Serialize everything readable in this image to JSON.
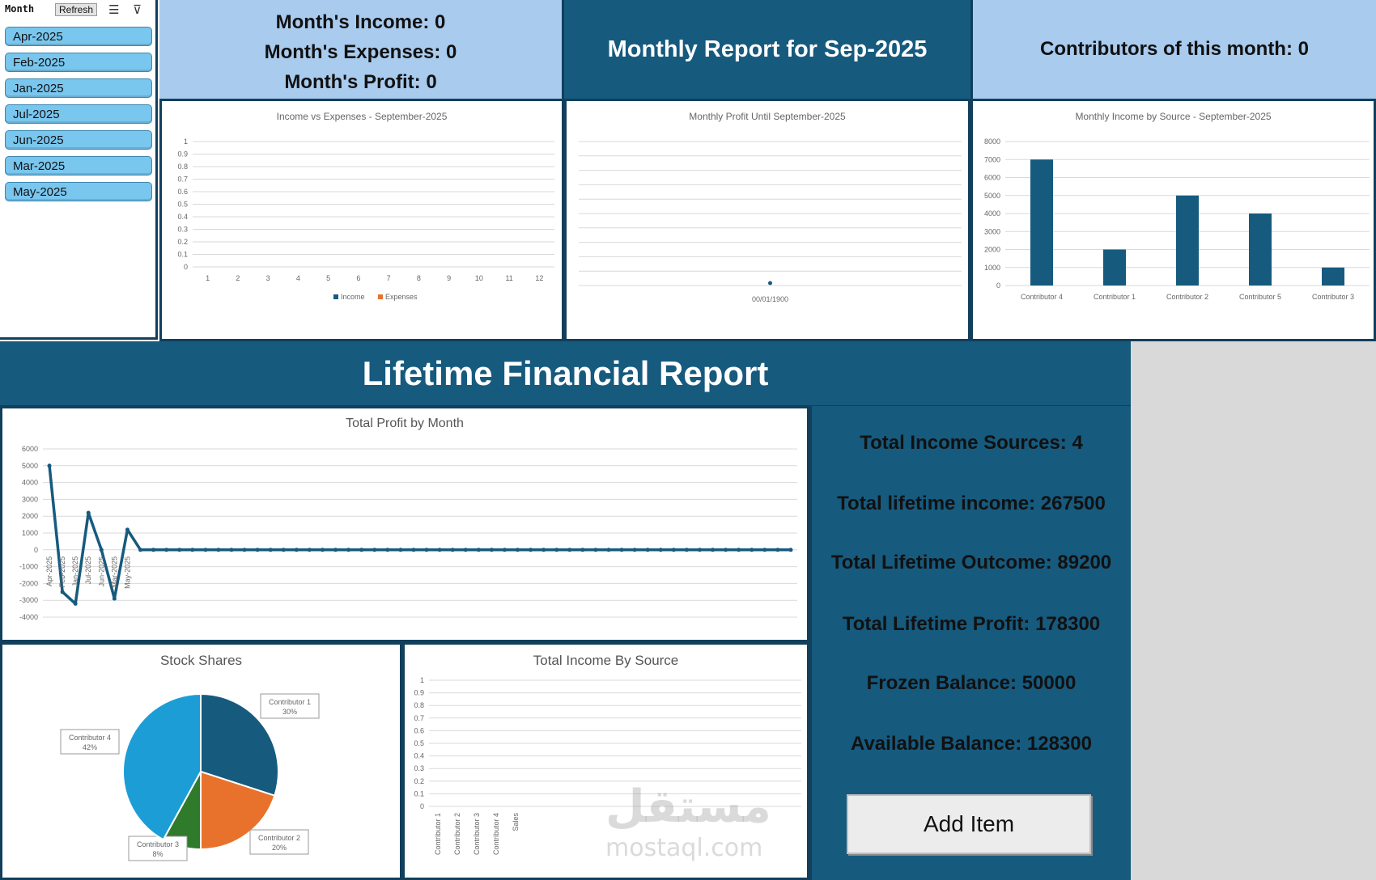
{
  "slicer": {
    "title": "Month",
    "refresh_label": "Refresh",
    "items": [
      "Apr-2025",
      "Feb-2025",
      "Jan-2025",
      "Jul-2025",
      "Jun-2025",
      "Mar-2025",
      "May-2025"
    ]
  },
  "monthly": {
    "income": "Month's Income: 0",
    "expenses": "Month's Expenses: 0",
    "profit": "Month's Profit: 0",
    "title": "Monthly Report for Sep-2025",
    "contributors": "Contributors of this month: 0"
  },
  "lifetime": {
    "title": "Lifetime Financial Report",
    "stats": [
      "Total Income Sources: 4",
      "Total lifetime income: 267500",
      "Total Lifetime Outcome: 89200",
      "Total Lifetime Profit: 178300",
      "Frozen Balance: 50000",
      "Available Balance: 128300"
    ],
    "add_item_label": "Add Item"
  },
  "watermark": {
    "arabic": "مستقل",
    "latin": "mostaql.com"
  },
  "colors": {
    "dark_blue": "#165a7e",
    "light_blue": "#a8cbee",
    "orange": "#e8722c",
    "green": "#2f7a2b",
    "cyan": "#1c9dd6"
  },
  "chart_data": [
    {
      "type": "bar",
      "title": "Income vs Expenses - September-2025",
      "categories": [
        "1",
        "2",
        "3",
        "4",
        "5",
        "6",
        "7",
        "8",
        "9",
        "10",
        "11",
        "12"
      ],
      "series": [
        {
          "name": "Income",
          "values": []
        },
        {
          "name": "Expenses",
          "values": []
        }
      ],
      "ylim": [
        0,
        1
      ],
      "yticks": [
        "0",
        "0.1",
        "0.2",
        "0.3",
        "0.4",
        "0.5",
        "0.6",
        "0.7",
        "0.8",
        "0.9",
        "1"
      ],
      "legend": "bottom"
    },
    {
      "type": "line",
      "title": "Monthly Profit Until September-2025",
      "categories": [
        "00/01/1900"
      ],
      "values": [
        0
      ]
    },
    {
      "type": "bar",
      "title": "Monthly Income by Source - September-2025",
      "categories": [
        "Contributor 4",
        "Contributor 1",
        "Contributor 2",
        "Contributor 5",
        "Contributor 3"
      ],
      "values": [
        7000,
        2000,
        5000,
        4000,
        1000
      ],
      "ylim": [
        0,
        8000
      ],
      "yticks": [
        "0",
        "1000",
        "2000",
        "3000",
        "4000",
        "5000",
        "6000",
        "7000",
        "8000"
      ]
    },
    {
      "type": "line",
      "title": "Total Profit by Month",
      "categories": [
        "Apr-2025",
        "Feb-2025",
        "Jan-2025",
        "Jul-2025",
        "Jun-2025",
        "Mar-2025",
        "May-2025"
      ],
      "values": [
        5000,
        -2500,
        -3200,
        2200,
        0,
        -2900,
        1200,
        0,
        0,
        0,
        0,
        0,
        0,
        0,
        0,
        0,
        0,
        0,
        0,
        0,
        0,
        0,
        0,
        0,
        0,
        0,
        0,
        0,
        0,
        0,
        0,
        0,
        0,
        0,
        0,
        0,
        0,
        0,
        0,
        0,
        0,
        0,
        0,
        0,
        0,
        0,
        0,
        0,
        0,
        0,
        0,
        0,
        0,
        0,
        0,
        0,
        0,
        0
      ],
      "ylim": [
        -4000,
        6000
      ],
      "yticks": [
        "-4000",
        "-3000",
        "-2000",
        "-1000",
        "0",
        "1000",
        "2000",
        "3000",
        "4000",
        "5000",
        "6000"
      ]
    },
    {
      "type": "pie",
      "title": "Stock Shares",
      "slices": [
        {
          "label": "Contributor 1",
          "value": 30,
          "pct": "30%"
        },
        {
          "label": "Contributor 2",
          "value": 20,
          "pct": "20%"
        },
        {
          "label": "Contributor 3",
          "value": 8,
          "pct": "8%"
        },
        {
          "label": "Contributor 4",
          "value": 42,
          "pct": "42%"
        }
      ]
    },
    {
      "type": "bar",
      "title": "Total Income By Source",
      "categories": [
        "Contributor 1",
        "Contributor 2",
        "Contributor 3",
        "Contributor 4",
        "Sales"
      ],
      "values": [],
      "ylim": [
        0,
        1
      ],
      "yticks": [
        "0",
        "0.1",
        "0.2",
        "0.3",
        "0.4",
        "0.5",
        "0.6",
        "0.7",
        "0.8",
        "0.9",
        "1"
      ]
    }
  ]
}
